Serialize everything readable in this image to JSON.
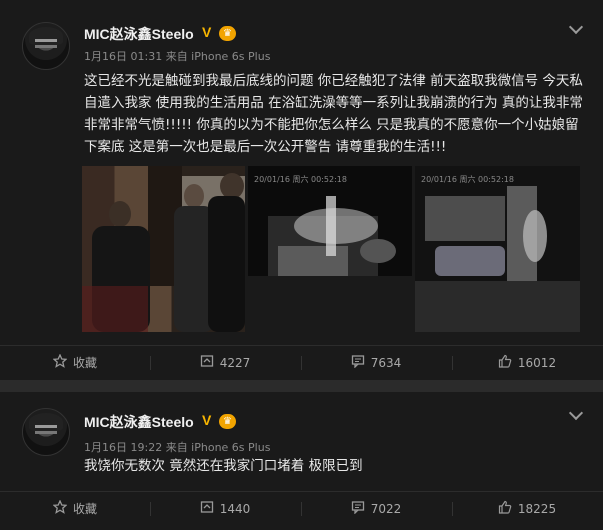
{
  "posts": [
    {
      "author": "MIC赵泳鑫Steelo",
      "verified_mark": "V",
      "vip_icon": "crown-badge-icon",
      "meta": "1月16日 01:31 来自 iPhone 6s Plus",
      "text": "这已经不光是触碰到我最后底线的问题 你已经触犯了法律 前天盗取我微信号 今天私自遣入我家 使用我的生活用品 在浴缸洗澡等等一系列让我崩溃的行为 真的让我非常非常非常气愤!!!!! 你真的以为不能把你怎么样么 只是我真的不愿意你一个小姑娘留下案底 这是第一次也是最后一次公开警告 请尊重我的生活!!!",
      "photo_captions": [
        "",
        "20/01/16 周六 00:52:18",
        "20/01/16 周六 00:52:18"
      ],
      "actions": {
        "favorite": "收藏",
        "repost": "4227",
        "comment": "7634",
        "like": "16012"
      }
    },
    {
      "author": "MIC赵泳鑫Steelo",
      "verified_mark": "V",
      "vip_icon": "crown-badge-icon",
      "meta": "1月16日 19:22 来自 iPhone 6s Plus",
      "text": "我饶你无数次 竟然还在我家门口堵着 极限已到",
      "actions": {
        "favorite": "收藏",
        "repost": "1440",
        "comment": "7022",
        "like": "18225"
      }
    }
  ],
  "colors": {
    "background": "#1a1a1a",
    "separator": "#2b2b2b",
    "text": "#e8e8e8",
    "meta": "#8a8a8a",
    "verified": "#f7b500"
  }
}
